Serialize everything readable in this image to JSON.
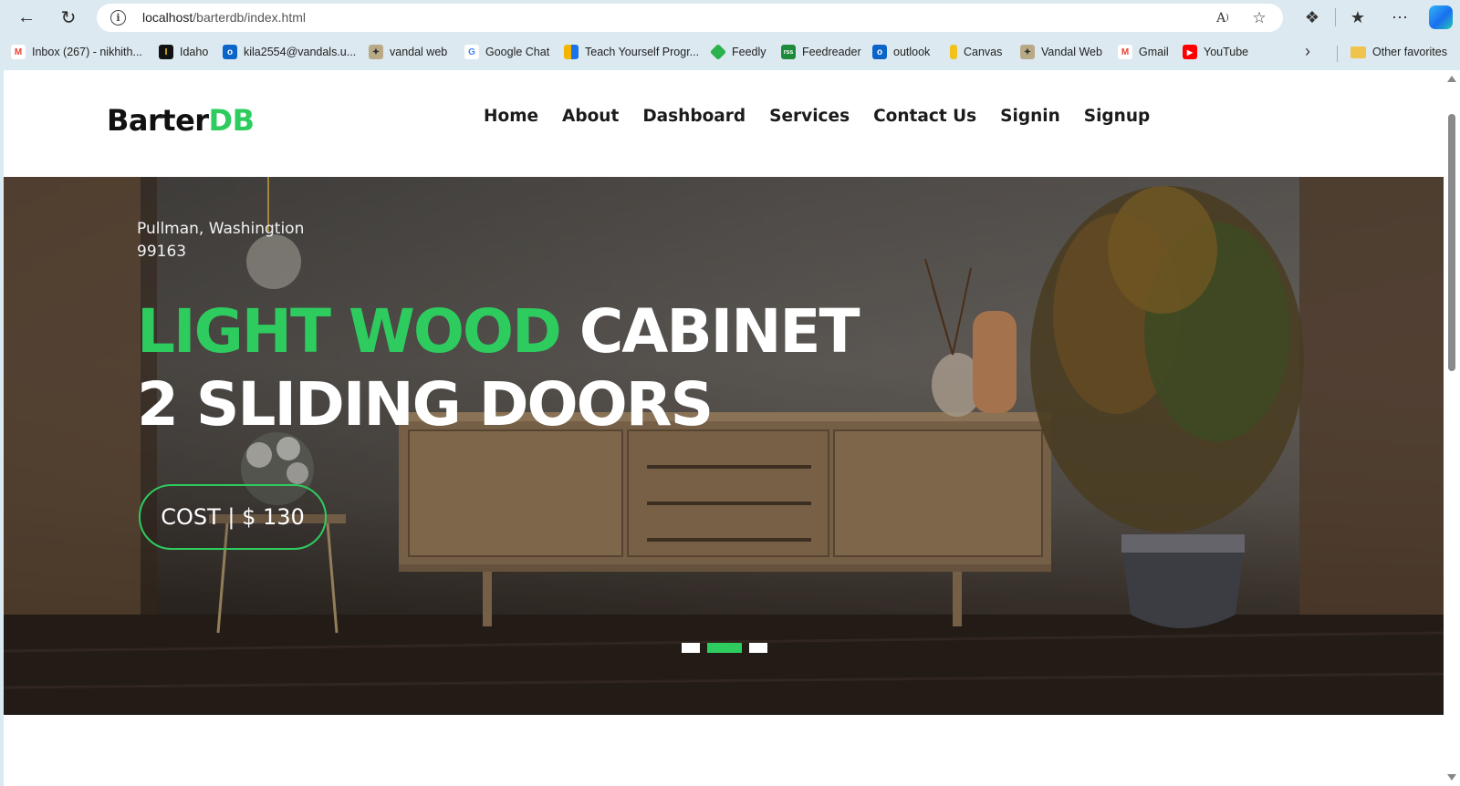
{
  "browser": {
    "url_host": "localhost",
    "url_path": "/barterdb/index.html",
    "bookmarks": [
      {
        "label": "Inbox (267) - nikhith...",
        "icon": "gmail-icon",
        "color": "#ea4335"
      },
      {
        "label": "Idaho",
        "icon": "idaho-icon",
        "color": "#111111"
      },
      {
        "label": "kila2554@vandals.u...",
        "icon": "outlook-icon",
        "color": "#0a64c9"
      },
      {
        "label": "vandal web",
        "icon": "vandal-icon",
        "color": "#8a7a5a"
      },
      {
        "label": "Google Chat",
        "icon": "google-icon",
        "color": "#4285f4"
      },
      {
        "label": "Teach Yourself Progr...",
        "icon": "bookmark-icon",
        "color": "#f4b400"
      },
      {
        "label": "Feedly",
        "icon": "feedly-icon",
        "color": "#2bb24c"
      },
      {
        "label": "Feedreader",
        "icon": "feedreader-icon",
        "color": "#1e8b3a"
      },
      {
        "label": "outlook",
        "icon": "outlook-icon",
        "color": "#0a64c9"
      },
      {
        "label": "Canvas",
        "icon": "canvas-icon",
        "color": "#f2c21b"
      },
      {
        "label": "Vandal Web",
        "icon": "vandal-icon",
        "color": "#8a7a5a"
      },
      {
        "label": "Gmail",
        "icon": "gmail-icon",
        "color": "#ea4335"
      },
      {
        "label": "YouTube",
        "icon": "youtube-icon",
        "color": "#ff0000"
      }
    ],
    "other_favorites": "Other favorites"
  },
  "site": {
    "logo_main": "Barter",
    "logo_accent": "DB",
    "nav": [
      "Home",
      "About",
      "Dashboard",
      "Services",
      "Contact Us",
      "Signin",
      "Signup"
    ]
  },
  "hero": {
    "location_line1": "Pullman, Washingtion",
    "location_line2": "99163",
    "headline_green": "LIGHT WOOD",
    "headline_white": "CABINET",
    "headline_line2": "2 SLIDING DOORS",
    "cost_label": "COST | $ 130",
    "slides_count": 3,
    "active_slide": 2
  },
  "colors": {
    "accent": "#2ecc5f",
    "chrome": "#dce9f0"
  }
}
